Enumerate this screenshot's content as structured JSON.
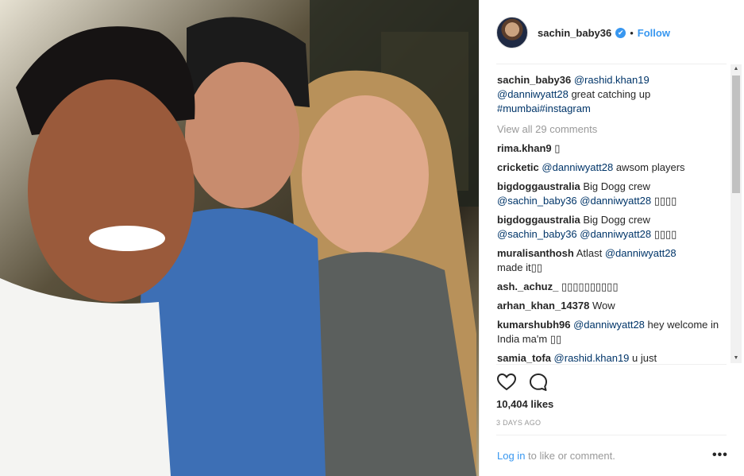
{
  "post": {
    "username": "sachin_baby36",
    "separator": "•",
    "follow_label": "Follow",
    "verified_mark": "✔"
  },
  "comments": {
    "caption": {
      "user": "sachin_baby36",
      "mention1": "@rashid.khan19",
      "mention2": "@danniwyatt28",
      "text": "great catching up",
      "tags": "#mumbai#instagram"
    },
    "view_all": "View all 29 comments",
    "items": [
      {
        "user": "rima.khan9",
        "mention": "",
        "text": "▯"
      },
      {
        "user": "cricketic",
        "mention": "@danniwyatt28",
        "text": "awsom players"
      },
      {
        "user": "bigdoggaustralia",
        "mention": "",
        "text": "Big Dogg crew",
        "mention2": "@sachin_baby36 @danniwyatt28",
        "text2": "▯▯▯▯"
      },
      {
        "user": "bigdoggaustralia",
        "mention": "",
        "text": "Big Dogg crew",
        "mention2": "@sachin_baby36 @danniwyatt28",
        "text2": "▯▯▯▯"
      },
      {
        "user": "muralisanthosh",
        "mention": "",
        "text": "Atlast",
        "mention2": "@danniwyatt28",
        "text2": "made it▯▯"
      },
      {
        "user": "ash._achuz_",
        "mention": "",
        "text": "▯▯▯▯▯▯▯▯▯▯"
      },
      {
        "user": "arhan_khan_14378",
        "mention": "",
        "text": "Wow"
      },
      {
        "user": "kumarshubh96",
        "mention": "@danniwyatt28",
        "text": "hey welcome in India ma'm ▯▯"
      },
      {
        "user": "samia_tofa",
        "mention": "@rashid.khan19",
        "text": "u just"
      }
    ]
  },
  "scrollbar": {
    "up": "▲",
    "down": "▼"
  },
  "actions": {
    "like_icon": "heart-icon",
    "comment_icon": "comment-icon"
  },
  "likes": "10,404 likes",
  "time_ago": "3 DAYS AGO",
  "footer": {
    "login_link": "Log in",
    "login_rest": "to like or comment.",
    "more": "•••"
  },
  "colors": {
    "link": "#3897f0",
    "mention": "#003569",
    "muted": "#999999"
  }
}
